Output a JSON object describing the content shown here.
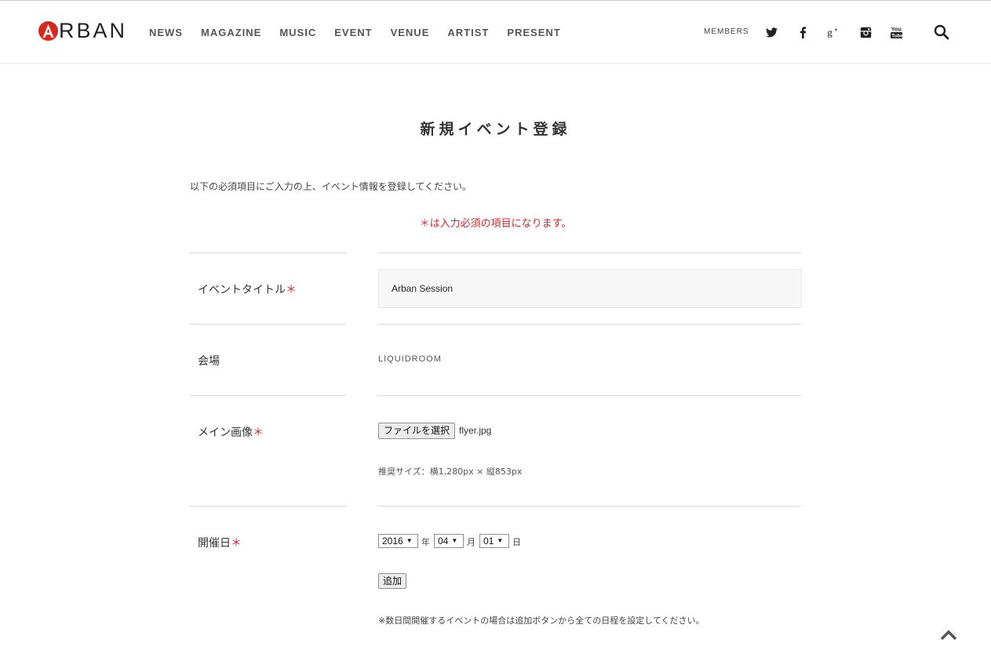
{
  "header": {
    "logo_text": "RBAN",
    "nav": [
      "NEWS",
      "MAGAZINE",
      "MUSIC",
      "EVENT",
      "VENUE",
      "ARTIST",
      "PRESENT"
    ],
    "members_label": "MEMBERS"
  },
  "page": {
    "title": "新規イベント登録",
    "intro": "以下の必須項目にご入力の上、イベント情報を登録してください。",
    "required_note": "＊は入力必須の項目になります。"
  },
  "form": {
    "title_label": "イベントタイトル",
    "title_value": "Arban Session",
    "venue_label": "会場",
    "venue_value": "LIQUIDROOM",
    "image_label": "メイン画像",
    "file_button": "ファイルを選択",
    "file_name": "flyer.jpg",
    "image_hint": "推奨サイズ：横1,280px × 縦853px",
    "date_label": "開催日",
    "year": "2016",
    "year_unit": "年",
    "month": "04",
    "month_unit": "月",
    "day": "01",
    "day_unit": "日",
    "add_button": "追加",
    "date_note": "※数日間開催するイベントの場合は追加ボタンから全ての日程を設定してください。",
    "required_mark": "＊"
  },
  "colors": {
    "accent_red": "#d8262c",
    "logo_red": "#d7261c",
    "input_bg": "#f7f7f7"
  }
}
